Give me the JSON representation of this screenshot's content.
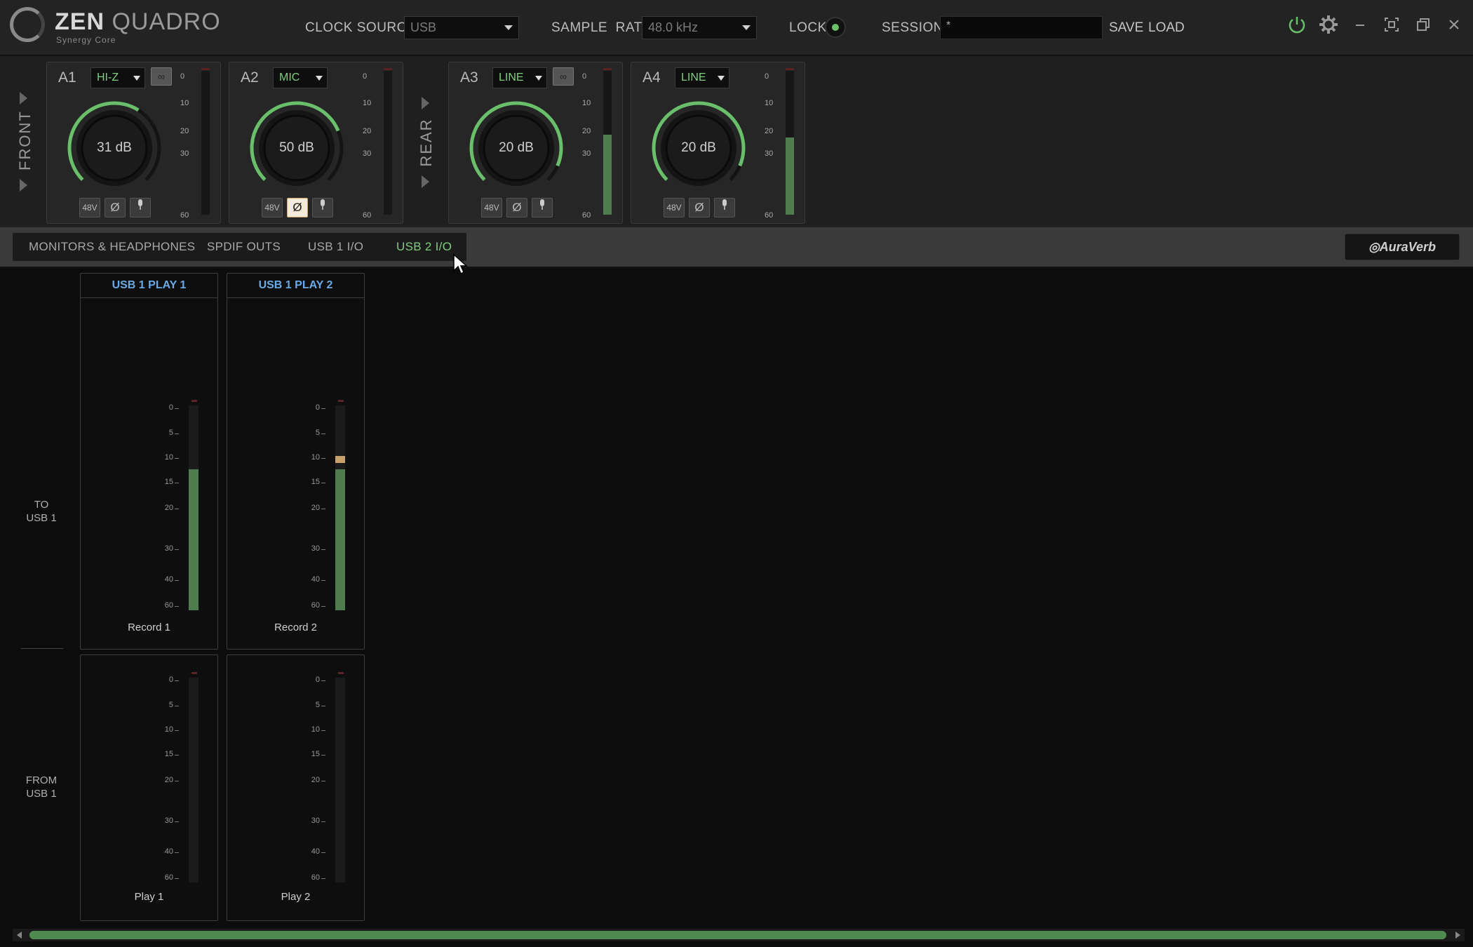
{
  "header": {
    "logo_main": "ZEN",
    "logo_second": "QUADRO",
    "logo_sub": "Synergy Core",
    "clock_source_label": "CLOCK SOURCE",
    "clock_source_value": "USB",
    "sample_rate_label": "SAMPLE  RATE",
    "sample_rate_value": "48.0 kHz",
    "lock_label": "LOCK",
    "session_label": "SESSION",
    "session_value": "*",
    "save_label": "SAVE",
    "load_label": "LOAD",
    "accent_color": "#6abf6a"
  },
  "strip": {
    "front_label": "FRONT",
    "rear_label": "REAR",
    "channels": [
      {
        "name": "A1",
        "type": "HI-Z",
        "gain": "31 dB",
        "gain_fraction": 0.62,
        "meter_level": 0,
        "phantom": "48V",
        "phase": "Ø",
        "phase_on": false,
        "linked": true
      },
      {
        "name": "A2",
        "type": "MIC",
        "gain": "50 dB",
        "gain_fraction": 0.75,
        "meter_level": 0,
        "phantom": "48V",
        "phase": "Ø",
        "phase_on": true,
        "linked": false
      },
      {
        "name": "A3",
        "type": "LINE",
        "gain": "20 dB",
        "gain_fraction": 0.92,
        "meter_level": 0.57,
        "phantom": "48V",
        "phase": "Ø",
        "phase_on": false,
        "linked": true
      },
      {
        "name": "A4",
        "type": "LINE",
        "gain": "20 dB",
        "gain_fraction": 0.92,
        "meter_level": 0.55,
        "phantom": "48V",
        "phase": "Ø",
        "phase_on": false,
        "linked": false
      }
    ],
    "meter_ticks": [
      "0",
      "10",
      "20",
      "30",
      "60"
    ]
  },
  "tabs": {
    "items": [
      "MONITORS & HEADPHONES",
      "SPDIF OUTS",
      "USB 1 I/O",
      "USB 2 I/O"
    ],
    "active": "USB 2 I/O",
    "brand_button": "AuraVerb"
  },
  "main": {
    "row_to": "TO\nUSB 1",
    "row_from": "FROM\nUSB 1",
    "panel_ticks": [
      "0",
      "5",
      "10",
      "15",
      "20",
      "30",
      "40",
      "60"
    ],
    "record": [
      {
        "header": "USB 1 PLAY 1",
        "label": "Record 1",
        "level": 0.69,
        "peak": null
      },
      {
        "header": "USB 1 PLAY 2",
        "label": "Record 2",
        "level": 0.69,
        "peak": 0.72
      }
    ],
    "play": [
      {
        "label": "Play 1",
        "level": 0
      },
      {
        "label": "Play 2",
        "level": 0
      }
    ]
  }
}
